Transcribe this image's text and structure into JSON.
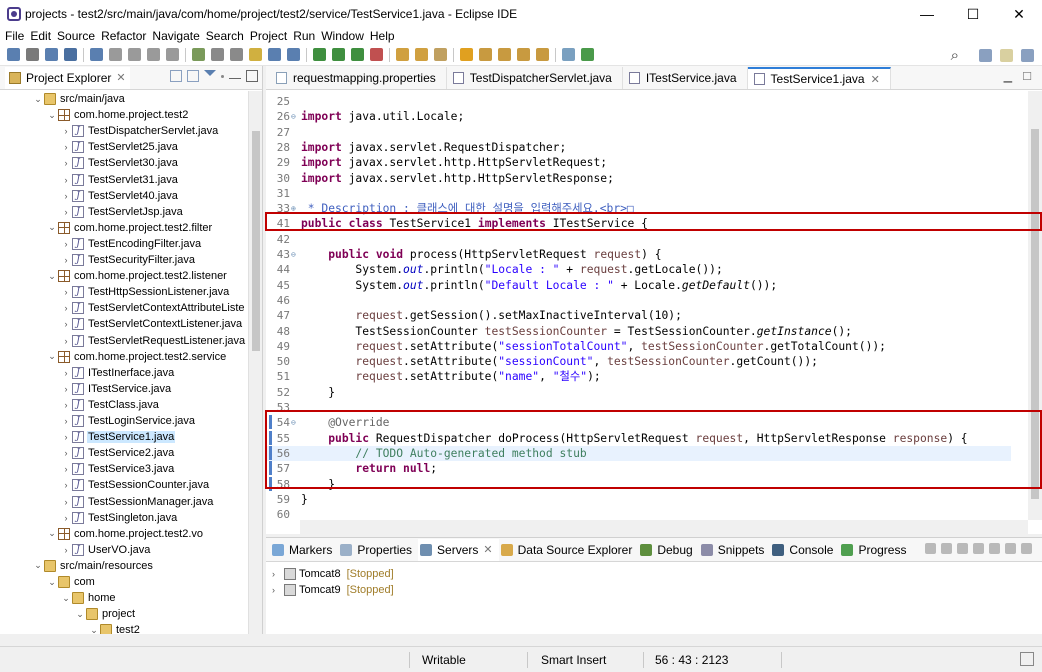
{
  "window": {
    "title": "projects - test2/src/main/java/com/home/project/test2/service/TestService1.java - Eclipse IDE",
    "minimize": "—",
    "maximize": "☐",
    "close": "✕"
  },
  "menu": [
    "File",
    "Edit",
    "Source",
    "Refactor",
    "Navigate",
    "Search",
    "Project",
    "Run",
    "Window",
    "Help"
  ],
  "explorer": {
    "tab_label": "Project Explorer",
    "tree": [
      {
        "label": "src/main/java",
        "depth": 2,
        "type": "folder",
        "expanded": true
      },
      {
        "label": "com.home.project.test2",
        "depth": 3,
        "type": "pkg",
        "expanded": true
      },
      {
        "label": "TestDispatcherServlet.java",
        "depth": 4,
        "type": "java"
      },
      {
        "label": "TestServlet25.java",
        "depth": 4,
        "type": "java"
      },
      {
        "label": "TestServlet30.java",
        "depth": 4,
        "type": "java"
      },
      {
        "label": "TestServlet31.java",
        "depth": 4,
        "type": "java"
      },
      {
        "label": "TestServlet40.java",
        "depth": 4,
        "type": "java"
      },
      {
        "label": "TestServletJsp.java",
        "depth": 4,
        "type": "java"
      },
      {
        "label": "com.home.project.test2.filter",
        "depth": 3,
        "type": "pkg",
        "expanded": true
      },
      {
        "label": "TestEncodingFilter.java",
        "depth": 4,
        "type": "java"
      },
      {
        "label": "TestSecurityFilter.java",
        "depth": 4,
        "type": "java"
      },
      {
        "label": "com.home.project.test2.listener",
        "depth": 3,
        "type": "pkg",
        "expanded": true
      },
      {
        "label": "TestHttpSessionListener.java",
        "depth": 4,
        "type": "java"
      },
      {
        "label": "TestServletContextAttributeListe",
        "depth": 4,
        "type": "java"
      },
      {
        "label": "TestServletContextListener.java",
        "depth": 4,
        "type": "java"
      },
      {
        "label": "TestServletRequestListener.java",
        "depth": 4,
        "type": "java"
      },
      {
        "label": "com.home.project.test2.service",
        "depth": 3,
        "type": "pkg",
        "expanded": true
      },
      {
        "label": "ITestInerface.java",
        "depth": 4,
        "type": "java"
      },
      {
        "label": "ITestService.java",
        "depth": 4,
        "type": "java"
      },
      {
        "label": "TestClass.java",
        "depth": 4,
        "type": "java"
      },
      {
        "label": "TestLoginService.java",
        "depth": 4,
        "type": "java"
      },
      {
        "label": "TestService1.java",
        "depth": 4,
        "type": "java",
        "selected": true
      },
      {
        "label": "TestService2.java",
        "depth": 4,
        "type": "java"
      },
      {
        "label": "TestService3.java",
        "depth": 4,
        "type": "java"
      },
      {
        "label": "TestSessionCounter.java",
        "depth": 4,
        "type": "java"
      },
      {
        "label": "TestSessionManager.java",
        "depth": 4,
        "type": "java"
      },
      {
        "label": "TestSingleton.java",
        "depth": 4,
        "type": "java"
      },
      {
        "label": "com.home.project.test2.vo",
        "depth": 3,
        "type": "pkg",
        "expanded": true
      },
      {
        "label": "UserVO.java",
        "depth": 4,
        "type": "java"
      },
      {
        "label": "src/main/resources",
        "depth": 2,
        "type": "folder",
        "expanded": true
      },
      {
        "label": "com",
        "depth": 3,
        "type": "folder",
        "expanded": true
      },
      {
        "label": "home",
        "depth": 4,
        "type": "folder",
        "expanded": true
      },
      {
        "label": "project",
        "depth": 5,
        "type": "folder",
        "expanded": true
      },
      {
        "label": "test2",
        "depth": 6,
        "type": "folder",
        "expanded": true
      }
    ]
  },
  "editor": {
    "tabs": [
      {
        "label": "requestmapping.properties",
        "icon": "properties"
      },
      {
        "label": "TestDispatcherServlet.java",
        "icon": "java"
      },
      {
        "label": "ITestService.java",
        "icon": "java"
      },
      {
        "label": "TestService1.java",
        "icon": "java",
        "active": true
      }
    ],
    "lines": [
      {
        "n": "25",
        "t": []
      },
      {
        "n": "26",
        "fold": "⊖",
        "t": [
          [
            "kw",
            "import"
          ],
          [
            "",
            "java.util.Locale;"
          ]
        ]
      },
      {
        "n": "27",
        "t": []
      },
      {
        "n": "28",
        "t": [
          [
            "kw",
            "import"
          ],
          [
            "",
            "javax.servlet.RequestDispatcher;"
          ]
        ]
      },
      {
        "n": "29",
        "t": [
          [
            "kw",
            "import"
          ],
          [
            "",
            "javax.servlet.http.HttpServletRequest;"
          ]
        ]
      },
      {
        "n": "30",
        "t": [
          [
            "kw",
            "import"
          ],
          [
            "",
            "javax.servlet.http.HttpServletResponse;"
          ]
        ]
      },
      {
        "n": "31",
        "t": []
      },
      {
        "n": "33",
        "fold": "⊕",
        "t": [
          [
            "jdoc",
            " * Description : 클래스에 대한 설명을 입력해주세요.<br>□"
          ]
        ]
      },
      {
        "n": "41",
        "t": [
          [
            "kw",
            "public"
          ],
          [
            "kw",
            "class"
          ],
          [
            "",
            "TestService1"
          ],
          [
            "kw",
            "implements"
          ],
          [
            "",
            "ITestService {"
          ]
        ]
      },
      {
        "n": "42",
        "t": []
      },
      {
        "n": "43",
        "fold": "⊖",
        "t": [
          [
            "",
            "    "
          ],
          [
            "kw",
            "public"
          ],
          [
            "kw",
            "void"
          ],
          [
            "",
            "process(HttpServletRequest"
          ],
          [
            "prm",
            "request"
          ],
          [
            "",
            ") {"
          ]
        ]
      },
      {
        "n": "44",
        "t": [
          [
            "",
            "        System."
          ],
          [
            "fld",
            "out"
          ],
          [
            "",
            ".println("
          ],
          [
            "str",
            "\"Locale : \""
          ],
          [
            "",
            ""
          ],
          [
            "",
            "+"
          ],
          [
            "prm",
            "request"
          ],
          [
            "",
            ".getLocale());"
          ]
        ]
      },
      {
        "n": "45",
        "t": [
          [
            "",
            "        System."
          ],
          [
            "fld",
            "out"
          ],
          [
            "",
            ".println("
          ],
          [
            "str",
            "\"Default Locale : \""
          ],
          [
            "",
            "+ Locale."
          ],
          [
            "sm",
            "getDefault"
          ],
          [
            "",
            "());"
          ]
        ]
      },
      {
        "n": "46",
        "t": []
      },
      {
        "n": "47",
        "t": [
          [
            "",
            "        "
          ],
          [
            "prm",
            "request"
          ],
          [
            "",
            ".getSession().setMaxInactiveInterval(10);"
          ]
        ]
      },
      {
        "n": "48",
        "t": [
          [
            "",
            "        TestSessionCounter"
          ],
          [
            "loc",
            "testSessionCounter"
          ],
          [
            "",
            "= TestSessionCounter."
          ],
          [
            "sm",
            "getInstance"
          ],
          [
            "",
            "();"
          ]
        ]
      },
      {
        "n": "49",
        "t": [
          [
            "",
            "        "
          ],
          [
            "prm",
            "request"
          ],
          [
            "",
            ".setAttribute("
          ],
          [
            "str",
            "\"sessionTotalCount\""
          ],
          [
            "",
            ","
          ],
          [
            "loc",
            "testSessionCounter"
          ],
          [
            "",
            ".getTotalCount());"
          ]
        ]
      },
      {
        "n": "50",
        "t": [
          [
            "",
            "        "
          ],
          [
            "prm",
            "request"
          ],
          [
            "",
            ".setAttribute("
          ],
          [
            "str",
            "\"sessionCount\""
          ],
          [
            "",
            ","
          ],
          [
            "loc",
            "testSessionCounter"
          ],
          [
            "",
            ".getCount());"
          ]
        ]
      },
      {
        "n": "51",
        "t": [
          [
            "",
            "        "
          ],
          [
            "prm",
            "request"
          ],
          [
            "",
            ".setAttribute("
          ],
          [
            "str",
            "\"name\""
          ],
          [
            "",
            ","
          ],
          [
            "str",
            "\"철수\""
          ],
          [
            "",
            ");"
          ]
        ]
      },
      {
        "n": "52",
        "t": [
          [
            "",
            "    }"
          ]
        ]
      },
      {
        "n": "53",
        "t": []
      },
      {
        "n": "54",
        "fold": "⊖",
        "t": [
          [
            "",
            "    "
          ],
          [
            "ann",
            "@Override"
          ]
        ]
      },
      {
        "n": "55",
        "t": [
          [
            "",
            "    "
          ],
          [
            "kw",
            "public"
          ],
          [
            "",
            "RequestDispatcher doProcess(HttpServletRequest"
          ],
          [
            "prm",
            "request"
          ],
          [
            "",
            ", HttpServletResponse"
          ],
          [
            "prm",
            "response"
          ],
          [
            "",
            ") {"
          ]
        ]
      },
      {
        "n": "56",
        "current": true,
        "t": [
          [
            "",
            "        "
          ],
          [
            "cmt",
            "// TODO Auto-generated method stub"
          ]
        ]
      },
      {
        "n": "57",
        "t": [
          [
            "",
            "        "
          ],
          [
            "kw",
            "return"
          ],
          [
            "kw",
            "null"
          ],
          [
            "",
            ";"
          ]
        ]
      },
      {
        "n": "58",
        "t": [
          [
            "",
            "    }"
          ]
        ]
      },
      {
        "n": "59",
        "t": [
          [
            "",
            "}"
          ]
        ]
      },
      {
        "n": "60",
        "t": []
      }
    ]
  },
  "bottom": {
    "tabs": [
      {
        "label": "Markers",
        "color": "#7aa7d6"
      },
      {
        "label": "Properties",
        "color": "#9bb0c8"
      },
      {
        "label": "Servers",
        "color": "#6f8fb0",
        "active": true
      },
      {
        "label": "Data Source Explorer",
        "color": "#d8a94a"
      },
      {
        "label": "Debug",
        "color": "#5e8f3e"
      },
      {
        "label": "Snippets",
        "color": "#8c8ca8"
      },
      {
        "label": "Console",
        "color": "#3f5f7f"
      },
      {
        "label": "Progress",
        "color": "#4f9f4f"
      }
    ],
    "servers": [
      {
        "name": "Tomcat8",
        "state": "[Stopped]"
      },
      {
        "name": "Tomcat9",
        "state": "[Stopped]"
      }
    ]
  },
  "status": {
    "mode": "Writable",
    "insert": "Smart Insert",
    "position": "56 : 43 : 2123"
  }
}
